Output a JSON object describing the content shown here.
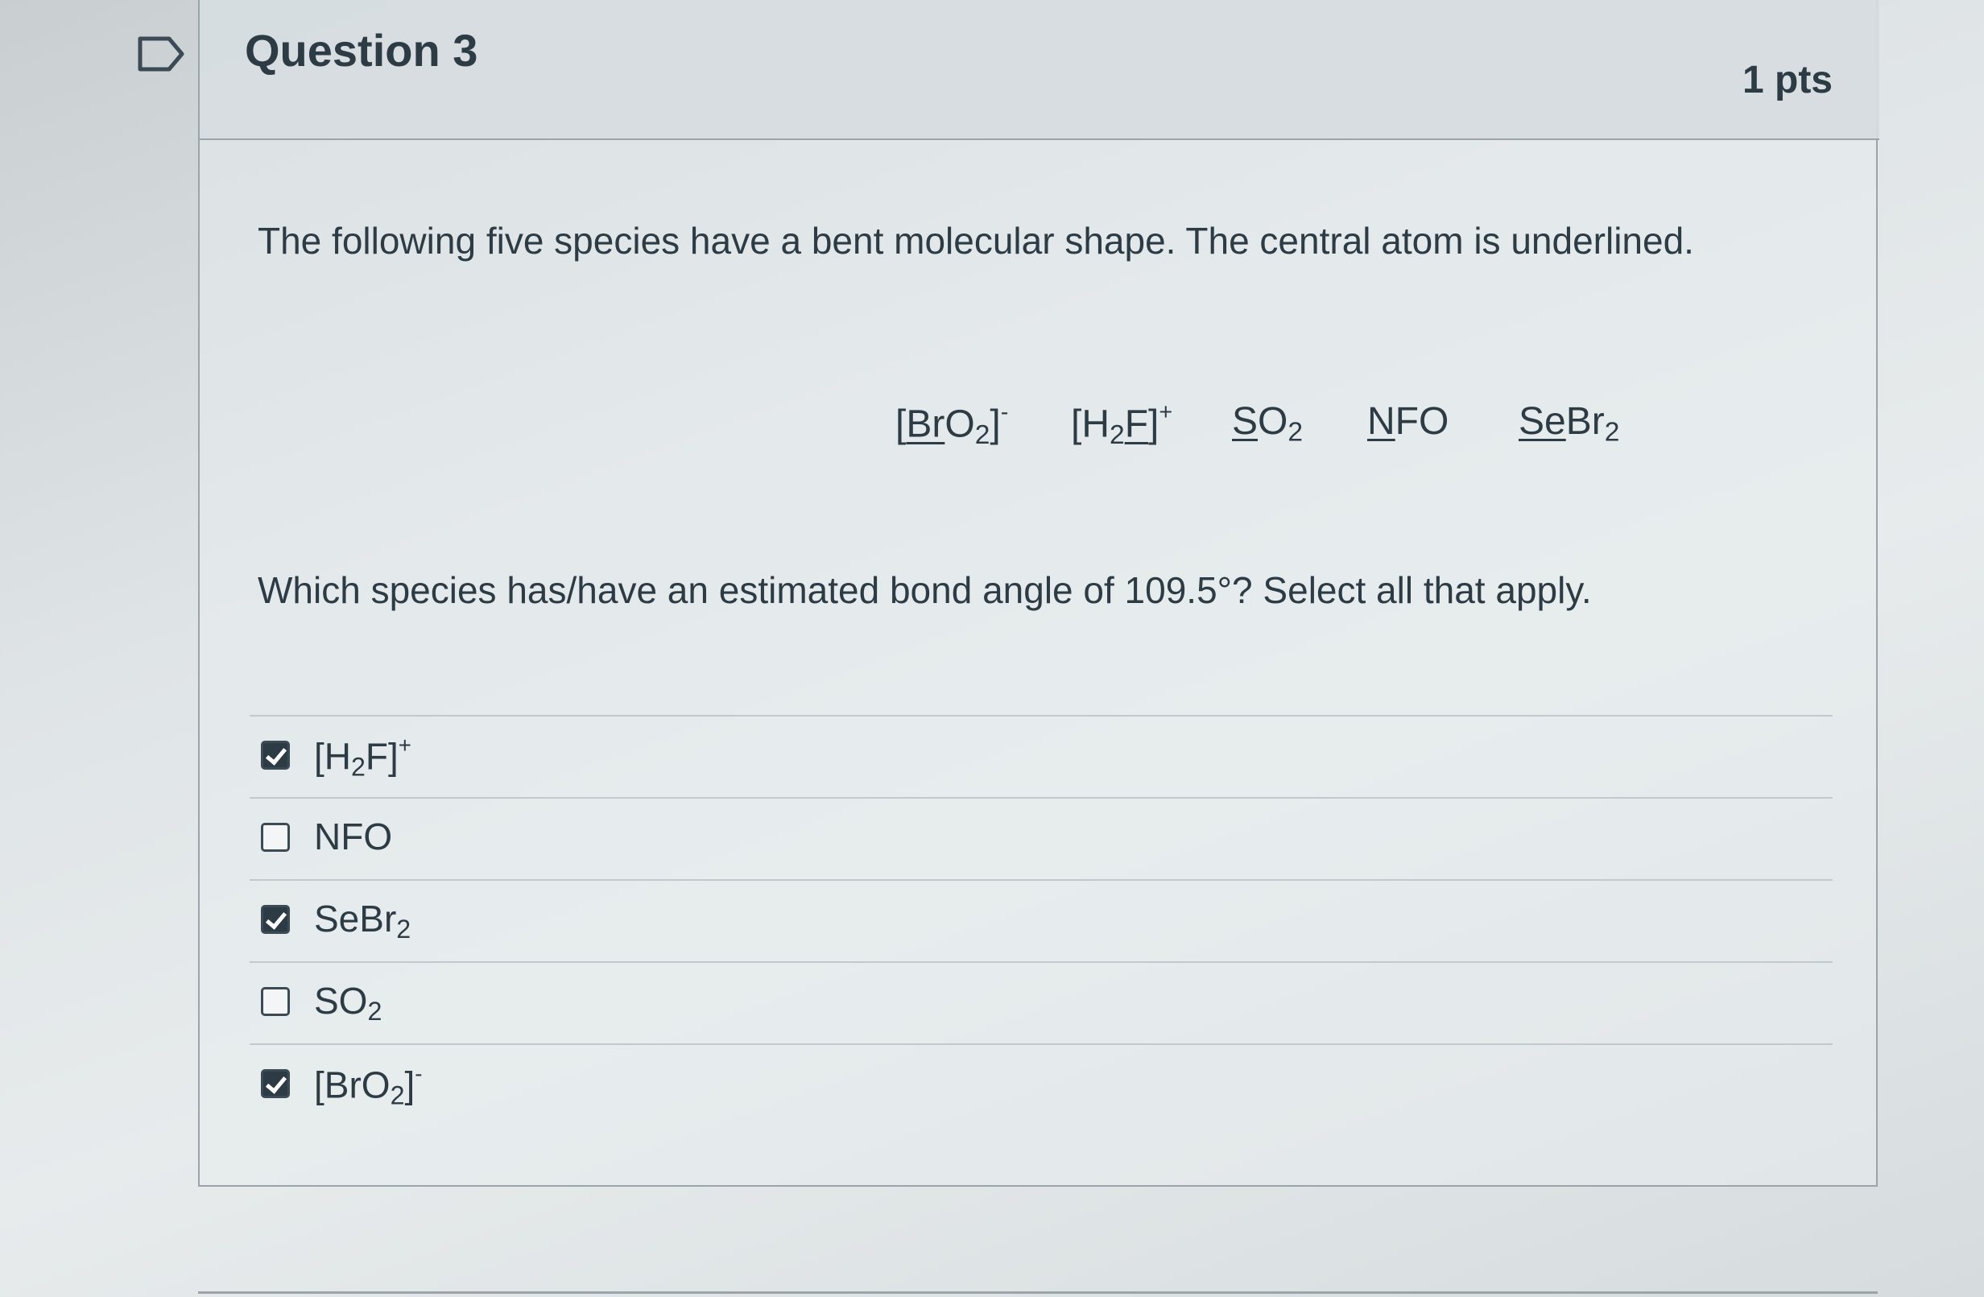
{
  "question": {
    "title": "Question 3",
    "points": "1 pts",
    "intro": "The following five species have a bent molecular shape. The central atom is underlined.",
    "prompt": "Which species has/have an estimated bond angle of 109.5°? Select all that apply."
  },
  "species": [
    {
      "pre": "[",
      "central": "Br",
      "post": "O",
      "sub": "2",
      "tail": "]",
      "sup": "-"
    },
    {
      "pre": "[H",
      "central": "",
      "post": "",
      "sub": "2",
      "tail": "F]",
      "sup": "+"
    },
    {
      "pre": "",
      "central": "S",
      "post": "O",
      "sub": "2",
      "tail": "",
      "sup": ""
    },
    {
      "pre": "",
      "central": "N",
      "post": "FO",
      "sub": "",
      "tail": "",
      "sup": ""
    },
    {
      "pre": "",
      "central": "Se",
      "post": "Br",
      "sub": "2",
      "tail": "",
      "sup": ""
    }
  ],
  "answers": [
    {
      "pre": "[H",
      "sub": "2",
      "post": "F]",
      "sup": "+",
      "checked": true
    },
    {
      "pre": "NFO",
      "sub": "",
      "post": "",
      "sup": "",
      "checked": false
    },
    {
      "pre": "SeBr",
      "sub": "2",
      "post": "",
      "sup": "",
      "checked": true
    },
    {
      "pre": "SO",
      "sub": "2",
      "post": "",
      "sup": "",
      "checked": false
    },
    {
      "pre": "[BrO",
      "sub": "2",
      "post": "]",
      "sup": "-",
      "checked": true
    }
  ],
  "colors": {
    "text": "#2d3b45",
    "border": "#9aa4aa",
    "checkbox_fill": "#2d3b45"
  }
}
